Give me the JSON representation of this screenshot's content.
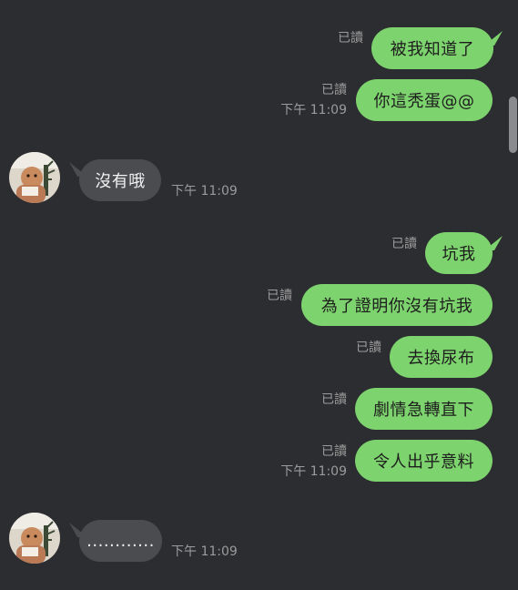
{
  "messages": [
    {
      "text": "被我知道了",
      "read": "已讀",
      "time": ""
    },
    {
      "text": "你這秃蛋@@",
      "read": "已讀",
      "time": "下午 11:09"
    },
    {
      "text": "沒有哦",
      "time": "下午 11:09"
    },
    {
      "text": "坑我",
      "read": "已讀",
      "time": ""
    },
    {
      "text": "為了證明你沒有坑我",
      "read": "已讀",
      "time": ""
    },
    {
      "text": "去換尿布",
      "read": "已讀",
      "time": ""
    },
    {
      "text": "劇情急轉直下",
      "read": "已讀",
      "time": ""
    },
    {
      "text": "令人出乎意料",
      "read": "已讀",
      "time": "下午 11:09"
    },
    {
      "text": "............",
      "time": "下午 11:09"
    }
  ],
  "colors": {
    "background": "#2c2d30",
    "outgoing_bubble": "#7dd36d",
    "incoming_bubble": "#4b4c50",
    "meta_text": "#9b9b9b"
  },
  "icons": {
    "contact_avatar": "avatar-photo"
  }
}
